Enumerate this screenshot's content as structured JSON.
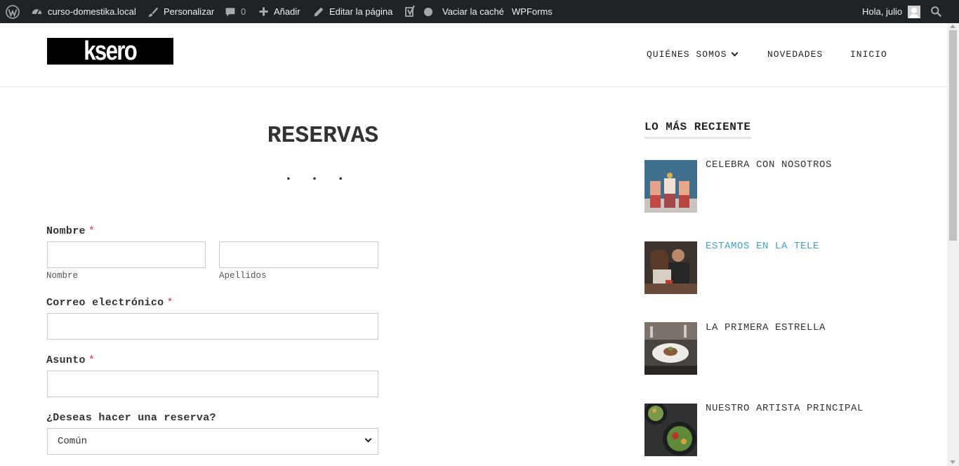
{
  "admin_bar": {
    "site_name": "curso-domestika.local",
    "customize": "Personalizar",
    "comments_count": "0",
    "add_new": "Añadir",
    "edit_page": "Editar la página",
    "clear_cache": "Vaciar la caché",
    "wpforms": "WPForms",
    "greeting": "Hola, julio"
  },
  "header": {
    "logo_text": "ksero",
    "nav": [
      "QUIÉNES SOMOS",
      "NOVEDADES",
      "INICIO"
    ]
  },
  "main": {
    "title": "RESERVAS",
    "separator": "...",
    "form": {
      "name_label": "Nombre",
      "first_name_sublabel": "Nombre",
      "last_name_sublabel": "Apellidos",
      "email_label": "Correo electrónico",
      "subject_label": "Asunto",
      "reservation_label": "¿Deseas hacer una reserva?",
      "reservation_value": "Común",
      "required_mark": "*"
    }
  },
  "sidebar": {
    "title": "LO MÁS RECIENTE",
    "posts": [
      {
        "title": "CELEBRA CON NOSOTROS"
      },
      {
        "title": "ESTAMOS EN LA TELE"
      },
      {
        "title": "LA PRIMERA ESTRELLA"
      },
      {
        "title": "NUESTRO ARTISTA PRINCIPAL"
      }
    ]
  },
  "colors": {
    "admin_bar_bg": "#1d2327",
    "required": "#d63638",
    "link_hover": "#3aa6c8"
  }
}
